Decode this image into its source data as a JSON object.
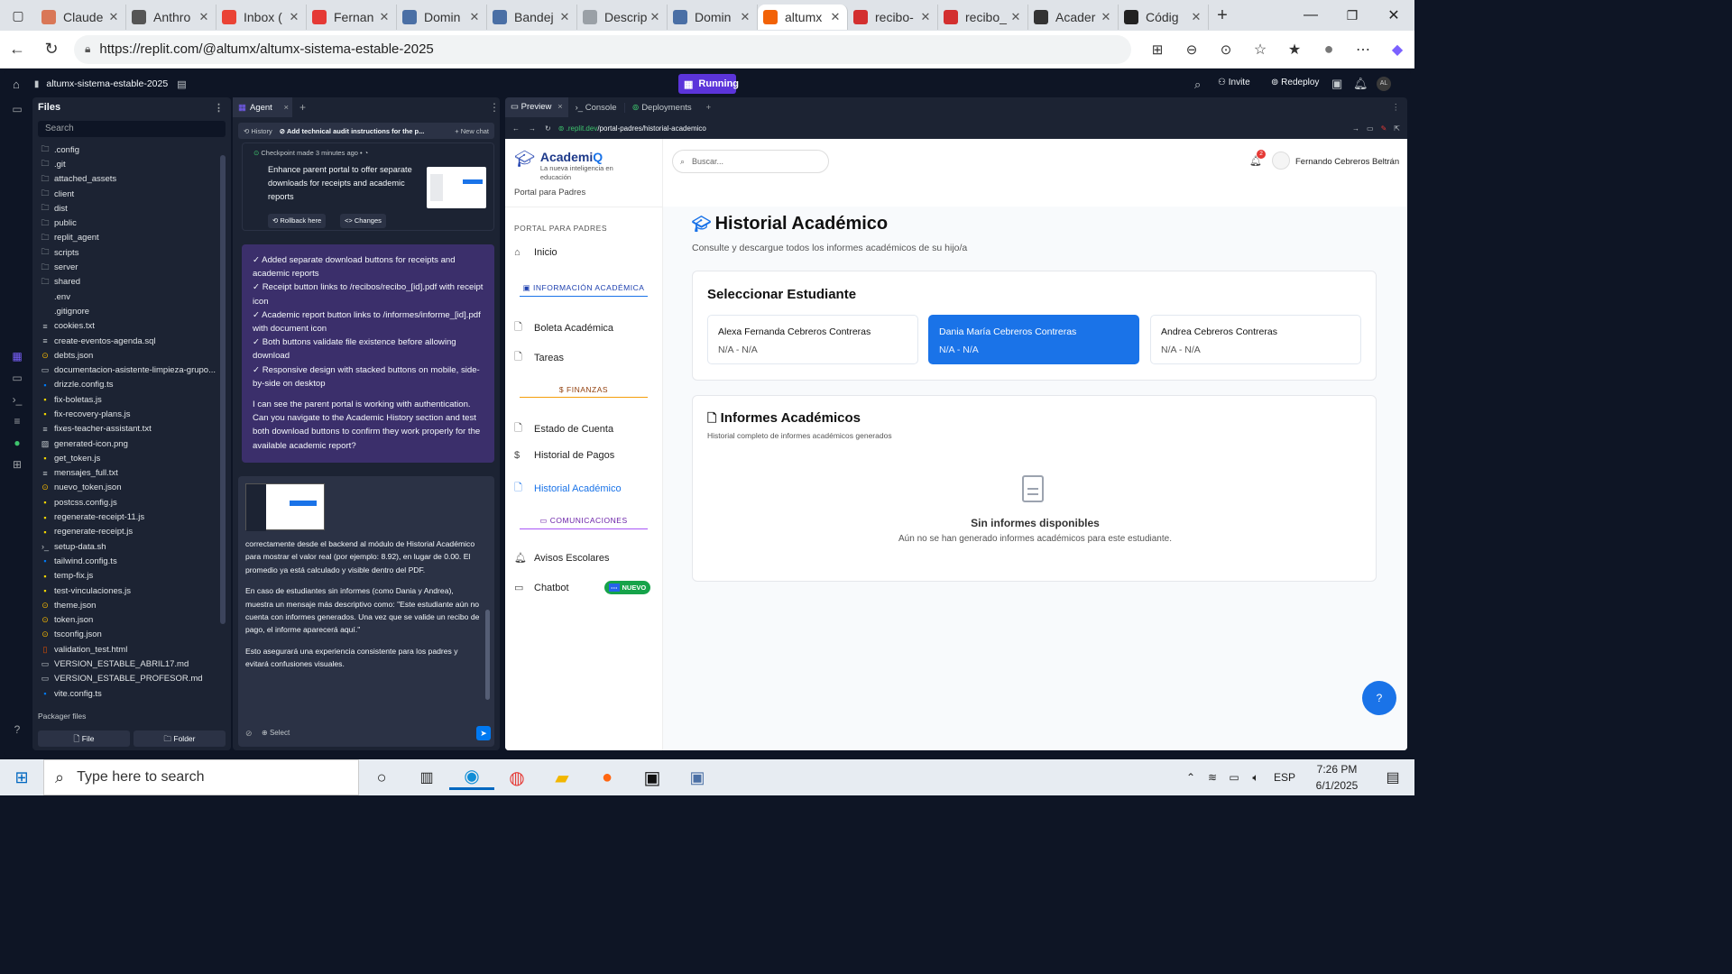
{
  "browser": {
    "tabs": [
      {
        "label": "Claude",
        "icon": "claude-icon",
        "color": "#d97757"
      },
      {
        "label": "Anthro",
        "icon": "anthropic-icon",
        "color": "#555555"
      },
      {
        "label": "Inbox (",
        "icon": "gmail-icon",
        "color": "#ea4335"
      },
      {
        "label": "Fernan",
        "icon": "news-icon",
        "color": "#e53935"
      },
      {
        "label": "Domin",
        "icon": "doc-icon",
        "color": "#4a6fa5"
      },
      {
        "label": "Bandej",
        "icon": "doc-icon",
        "color": "#4a6fa5"
      },
      {
        "label": "Descrip",
        "icon": "doc-icon",
        "color": "#9aa0a6"
      },
      {
        "label": "Domin",
        "icon": "doc-icon",
        "color": "#4a6fa5"
      },
      {
        "label": "altumx",
        "icon": "replit-icon",
        "color": "#f26207",
        "active": true
      },
      {
        "label": "recibo-",
        "icon": "pdf-icon",
        "color": "#d32f2f"
      },
      {
        "label": "recibo_",
        "icon": "pdf-icon",
        "color": "#d32f2f"
      },
      {
        "label": "Acader",
        "icon": "globe-icon",
        "color": "#333333"
      },
      {
        "label": "Códig",
        "icon": "openai-icon",
        "color": "#222222"
      }
    ],
    "url": "https://replit.com/@altumx/altumx-sistema-estable-2025"
  },
  "replit": {
    "project_name": "altumx-sistema-estable-2025",
    "status": "Running",
    "invite": "Invite",
    "redeploy": "Redeploy",
    "avatar": "AL",
    "files_title": "Files",
    "search_placeholder": "Search",
    "files": [
      {
        "name": ".config",
        "type": "folder"
      },
      {
        "name": ".git",
        "type": "folder"
      },
      {
        "name": "attached_assets",
        "type": "folder"
      },
      {
        "name": "client",
        "type": "folder"
      },
      {
        "name": "dist",
        "type": "folder"
      },
      {
        "name": "public",
        "type": "folder"
      },
      {
        "name": "replit_agent",
        "type": "folder"
      },
      {
        "name": "scripts",
        "type": "folder"
      },
      {
        "name": "server",
        "type": "folder"
      },
      {
        "name": "shared",
        "type": "folder"
      },
      {
        "name": ".env",
        "type": "file"
      },
      {
        "name": ".gitignore",
        "type": "file"
      },
      {
        "name": "cookies.txt",
        "type": "text"
      },
      {
        "name": "create-eventos-agenda.sql",
        "type": "text"
      },
      {
        "name": "debts.json",
        "type": "json"
      },
      {
        "name": "documentacion-asistente-limpieza-grupo...",
        "type": "md"
      },
      {
        "name": "drizzle.config.ts",
        "type": "ts"
      },
      {
        "name": "fix-boletas.js",
        "type": "js"
      },
      {
        "name": "fix-recovery-plans.js",
        "type": "js"
      },
      {
        "name": "fixes-teacher-assistant.txt",
        "type": "text"
      },
      {
        "name": "generated-icon.png",
        "type": "img"
      },
      {
        "name": "get_token.js",
        "type": "js"
      },
      {
        "name": "mensajes_full.txt",
        "type": "text"
      },
      {
        "name": "nuevo_token.json",
        "type": "json"
      },
      {
        "name": "postcss.config.js",
        "type": "js"
      },
      {
        "name": "regenerate-receipt-11.js",
        "type": "js"
      },
      {
        "name": "regenerate-receipt.js",
        "type": "js"
      },
      {
        "name": "setup-data.sh",
        "type": "sh"
      },
      {
        "name": "tailwind.config.ts",
        "type": "ts"
      },
      {
        "name": "temp-fix.js",
        "type": "js"
      },
      {
        "name": "test-vinculaciones.js",
        "type": "js"
      },
      {
        "name": "theme.json",
        "type": "json"
      },
      {
        "name": "token.json",
        "type": "json"
      },
      {
        "name": "tsconfig.json",
        "type": "json"
      },
      {
        "name": "validation_test.html",
        "type": "html"
      },
      {
        "name": "VERSION_ESTABLE_ABRIL17.md",
        "type": "md"
      },
      {
        "name": "VERSION_ESTABLE_PROFESOR.md",
        "type": "md"
      },
      {
        "name": "vite.config.ts",
        "type": "ts"
      }
    ],
    "packager_files": "Packager files",
    "new_file": "File",
    "new_folder": "Folder"
  },
  "agent": {
    "tab": "Agent",
    "history": "History",
    "thread_title": "Add technical audit instructions for the p...",
    "new_chat": "New chat",
    "checkpoint": "Checkpoint made 3 minutes ago",
    "checkpoint_desc": "Enhance parent portal to offer separate downloads for receipts and academic reports",
    "rollback": "Rollback here",
    "changes": "Changes",
    "bullets": [
      "✓ Added separate download buttons for receipts and academic reports",
      "✓ Receipt button links to /recibos/recibo_[id].pdf with receipt icon",
      "✓ Academic report button links to /informes/informe_[id].pdf with document icon",
      "✓ Both buttons validate file existence before allowing download",
      "✓ Responsive design with stacked buttons on mobile, side-by-side on desktop"
    ],
    "question": "I can see the parent portal is working with authentication. Can you navigate to the Academic History section and test both download buttons to confirm they work properly for the available academic report?",
    "reply_p1": "correctamente desde el backend al módulo de Historial Académico para mostrar el valor real (por ejemplo: 8.92), en lugar de 0.00. El promedio ya está calculado y visible dentro del PDF.",
    "reply_p2": "En caso de estudiantes sin informes (como Dania y Andrea), muestra un mensaje más descriptivo como: \"Este estudiante aún no cuenta con informes generados. Una vez que se valide un recibo de pago, el informe aparecerá aquí.\"",
    "reply_p3": "Esto asegurará una experiencia consistente para los padres y evitará confusiones visuales.",
    "select": "Select"
  },
  "preview": {
    "tabs": [
      "Preview",
      "Console",
      "Deployments"
    ],
    "url_host": ".replit.dev",
    "url_path": "/portal-padres/historial-academico"
  },
  "app": {
    "brand": "AcademiQ",
    "brand_part1": "Academi",
    "brand_part2": "Q",
    "tagline": "La nueva inteligencia en educación",
    "portal": "Portal para Padres",
    "search_placeholder": "Buscar...",
    "notifications": "2",
    "user": "Fernando Cebreros Beltrán",
    "nav": {
      "section_portal": "PORTAL PARA PADRES",
      "inicio": "Inicio",
      "section_academic": "INFORMACIÓN ACADÉMICA",
      "boleta": "Boleta Académica",
      "tareas": "Tareas",
      "section_finanzas": "FINANZAS",
      "estado": "Estado de Cuenta",
      "pagos": "Historial de Pagos",
      "historial": "Historial Académico",
      "section_com": "COMUNICACIONES",
      "avisos": "Avisos Escolares",
      "chatbot": "Chatbot",
      "nuevo": "NUEVO"
    },
    "page_title": "Historial Académico",
    "page_subtitle": "Consulte y descargue todos los informes académicos de su hijo/a",
    "select_title": "Seleccionar Estudiante",
    "students": [
      {
        "name": "Alexa Fernanda Cebreros Contreras",
        "sub": "N/A - N/A",
        "selected": false
      },
      {
        "name": "Dania María Cebreros Contreras",
        "sub": "N/A - N/A",
        "selected": true
      },
      {
        "name": "Andrea Cebreros Contreras",
        "sub": "N/A - N/A",
        "selected": false
      }
    ],
    "reports_title": "Informes Académicos",
    "reports_subtitle": "Historial completo de informes académicos generados",
    "empty_title": "Sin informes disponibles",
    "empty_text": "Aún no se han generado informes académicos para este estudiante.",
    "accent": "#1a73e8"
  },
  "taskbar": {
    "search_placeholder": "Type here to search",
    "lang": "ESP",
    "time": "7:26 PM",
    "date": "6/1/2025"
  }
}
